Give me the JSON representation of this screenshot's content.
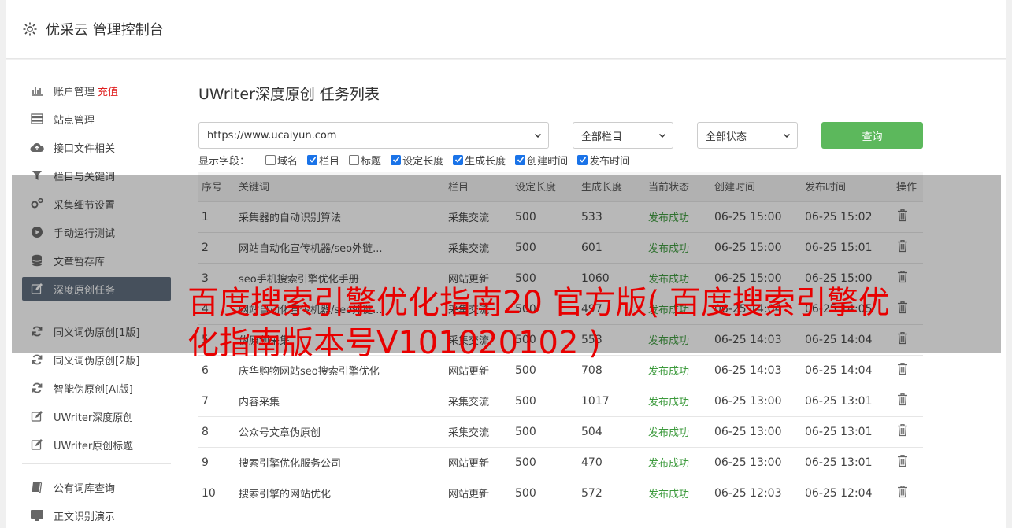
{
  "header": {
    "title": "优采云 管理控制台"
  },
  "sidebar": {
    "group1": [
      {
        "label": "账户管理",
        "extra": "充值",
        "icon": "bar-chart-icon",
        "active": false
      },
      {
        "label": "站点管理",
        "icon": "server-icon",
        "active": false
      },
      {
        "label": "接口文件相关",
        "icon": "cloud-upload-icon",
        "active": false
      },
      {
        "label": "栏目与关键词",
        "icon": "filter-icon",
        "active": false
      },
      {
        "label": "采集细节设置",
        "icon": "gears-icon",
        "active": false
      },
      {
        "label": "手动运行测试",
        "icon": "play-circle-icon",
        "active": false
      },
      {
        "label": "文章暂存库",
        "icon": "database-icon",
        "active": false
      },
      {
        "label": "深度原创任务",
        "icon": "edit-icon",
        "active": true
      }
    ],
    "group2": [
      {
        "label": "同义词伪原创[1版]",
        "icon": "refresh-icon"
      },
      {
        "label": "同义词伪原创[2版]",
        "icon": "refresh-icon"
      },
      {
        "label": "智能伪原创[AI版]",
        "icon": "refresh-icon"
      },
      {
        "label": "UWriter深度原创",
        "icon": "edit-icon"
      },
      {
        "label": "UWriter原创标题",
        "icon": "edit-icon"
      }
    ],
    "group3": [
      {
        "label": "公有词库查询",
        "icon": "book-icon"
      },
      {
        "label": "正文识别演示",
        "icon": "monitor-icon"
      }
    ]
  },
  "main": {
    "title": "UWriter深度原创 任务列表",
    "site_select": "https://www.ucaiyun.com",
    "column_select": "全部栏目",
    "status_select": "全部状态",
    "query_label": "查询",
    "fields_label": "显示字段：",
    "fields": [
      {
        "label": "域名",
        "checked": false
      },
      {
        "label": "栏目",
        "checked": true
      },
      {
        "label": "标题",
        "checked": false
      },
      {
        "label": "设定长度",
        "checked": true
      },
      {
        "label": "生成长度",
        "checked": true
      },
      {
        "label": "创建时间",
        "checked": true
      },
      {
        "label": "发布时间",
        "checked": true
      }
    ],
    "table": {
      "headers": [
        "序号",
        "关键词",
        "栏目",
        "设定长度",
        "生成长度",
        "当前状态",
        "创建时间",
        "发布时间",
        "操作"
      ],
      "rows": [
        [
          "1",
          "采集器的自动识别算法",
          "采集交流",
          "500",
          "533",
          "发布成功",
          "06-25 15:00",
          "06-25 15:02"
        ],
        [
          "2",
          "网站自动化宣传机器/seo外链...",
          "采集交流",
          "500",
          "601",
          "发布成功",
          "06-25 15:00",
          "06-25 15:01"
        ],
        [
          "3",
          "seo手机搜索引擎优化手册",
          "网站更新",
          "500",
          "1060",
          "发布成功",
          "06-25 15:00",
          "06-25 15:00"
        ],
        [
          "4",
          "网站自动化宣传机器/seo外链...",
          "采集交流",
          "500",
          "497",
          "发布成功",
          "06-25 14:04",
          "06-25 14:05"
        ],
        [
          "5",
          "伪原创采集",
          "采集交流",
          "500",
          "553",
          "发布成功",
          "06-25 14:03",
          "06-25 14:04"
        ],
        [
          "6",
          "庆华购物网站seo搜索引擎优化",
          "网站更新",
          "500",
          "708",
          "发布成功",
          "06-25 14:03",
          "06-25 14:04"
        ],
        [
          "7",
          "内容采集",
          "采集交流",
          "500",
          "1017",
          "发布成功",
          "06-25 13:00",
          "06-25 13:01"
        ],
        [
          "8",
          "公众号文章伪原创",
          "采集交流",
          "500",
          "504",
          "发布成功",
          "06-25 13:00",
          "06-25 13:01"
        ],
        [
          "9",
          "搜索引擎优化服务公司",
          "网站更新",
          "500",
          "470",
          "发布成功",
          "06-25 13:00",
          "06-25 13:01"
        ],
        [
          "10",
          "搜索引擎的网站优化",
          "网站更新",
          "500",
          "572",
          "发布成功",
          "06-25 12:03",
          "06-25 12:04"
        ]
      ]
    }
  },
  "overlay": {
    "headline": "百度搜索引擎优化指南20 官方版( 百度搜索引擎优化指南版本号V101020102 )"
  },
  "colors": {
    "accent_green": "#5cb85c",
    "status_green": "#3c9a3c",
    "active_nav": "#5c6b7c",
    "headline_red": "#e80000"
  }
}
